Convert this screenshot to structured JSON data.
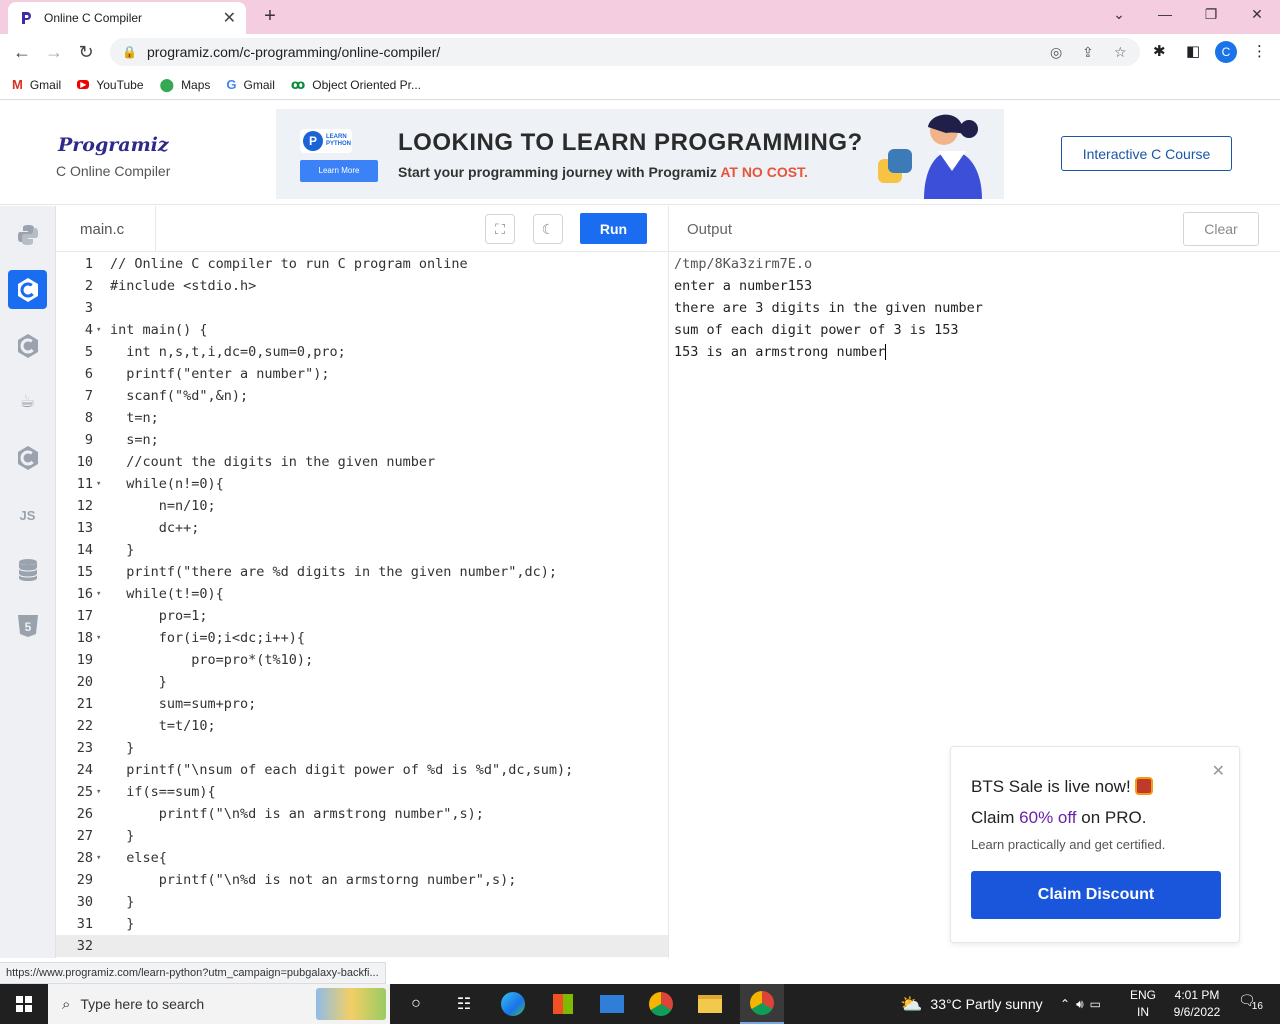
{
  "browser": {
    "tab_title": "Online C Compiler",
    "url": "programiz.com/c-programming/online-compiler/",
    "bookmarks": [
      "Gmail",
      "YouTube",
      "Maps",
      "Gmail",
      "Object Oriented Pr..."
    ],
    "profile_initial": "C"
  },
  "site": {
    "logo": "Programiz",
    "subtitle": "C Online Compiler",
    "ad": {
      "badge": "LEARN PYTHON",
      "more": "Learn More",
      "headline": "LOOKING TO LEARN PROGRAMMING?",
      "sub_prefix": "Start your programming journey with Programiz ",
      "sub_highlight": "AT NO COST."
    },
    "course_button": "Interactive C Course"
  },
  "editor": {
    "filename": "main.c",
    "run_label": "Run",
    "lines": [
      "// Online C compiler to run C program online",
      "#include <stdio.h>",
      "",
      "int main() {",
      "  int n,s,t,i,dc=0,sum=0,pro;",
      "  printf(\"enter a number\");",
      "  scanf(\"%d\",&n);",
      "  t=n;",
      "  s=n;",
      "  //count the digits in the given number",
      "  while(n!=0){",
      "      n=n/10;",
      "      dc++;",
      "  }",
      "  printf(\"there are %d digits in the given number\",dc);",
      "  while(t!=0){",
      "      pro=1;",
      "      for(i=0;i<dc;i++){",
      "          pro=pro*(t%10);",
      "      }",
      "      sum=sum+pro;",
      "      t=t/10;",
      "  }",
      "  printf(\"\\nsum of each digit power of %d is %d\",dc,sum);",
      "  if(s==sum){",
      "      printf(\"\\n%d is an armstrong number\",s);",
      "  }",
      "  else{",
      "      printf(\"\\n%d is not an armstorng number\",s);",
      "  }",
      "  }",
      ""
    ],
    "fold_lines": [
      4,
      11,
      16,
      18,
      25,
      28
    ]
  },
  "output": {
    "label": "Output",
    "clear_label": "Clear",
    "lines": [
      "/tmp/8Ka3zirm7E.o",
      "enter a number153",
      "there are 3 digits in the given number",
      "sum of each digit power of 3 is 153",
      "153 is an armstrong number"
    ]
  },
  "promo": {
    "line1": "BTS Sale is live now!",
    "line2_prefix": "Claim ",
    "line2_highlight": "60% off",
    "line2_suffix": " on PRO.",
    "line3": "Learn practically and get certified.",
    "button": "Claim Discount"
  },
  "status_url": "https://www.programiz.com/learn-python?utm_campaign=pubgalaxy-backfi...",
  "taskbar": {
    "search_placeholder": "Type here to search",
    "weather": "33°C  Partly sunny",
    "lang_top": "ENG",
    "lang_bottom": "IN",
    "time": "4:01 PM",
    "date": "9/6/2022",
    "notifications": "16"
  },
  "colors": {
    "accent": "#1a6cf0",
    "tabstrip": "#f4cde0",
    "taskbar": "#202020"
  }
}
